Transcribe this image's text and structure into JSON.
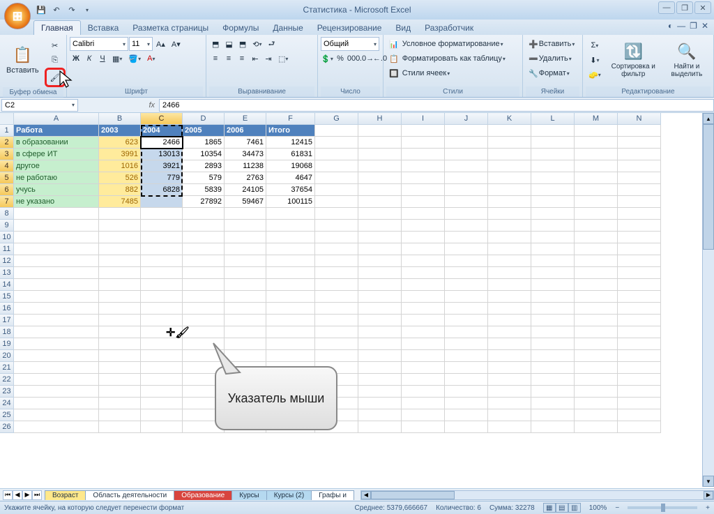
{
  "title": "Статистика - Microsoft Excel",
  "tabs": [
    "Главная",
    "Вставка",
    "Разметка страницы",
    "Формулы",
    "Данные",
    "Рецензирование",
    "Вид",
    "Разработчик"
  ],
  "active_tab": 0,
  "clipboard": {
    "paste": "Вставить",
    "label": "Буфер обмена"
  },
  "font": {
    "name": "Calibri",
    "size": "11",
    "label": "Шрифт",
    "bold": "Ж",
    "italic": "К",
    "underline": "Ч"
  },
  "align": {
    "label": "Выравнивание"
  },
  "number": {
    "label": "Число",
    "format": "Общий"
  },
  "styles": {
    "label": "Стили",
    "cond": "Условное форматирование",
    "table": "Форматировать как таблицу",
    "cell": "Стили ячеек"
  },
  "cells": {
    "label": "Ячейки",
    "insert": "Вставить",
    "delete": "Удалить",
    "format": "Формат"
  },
  "editing": {
    "label": "Редактирование",
    "sort": "Сортировка и фильтр",
    "find": "Найти и выделить"
  },
  "namebox": "C2",
  "formula": "2466",
  "columns": [
    "A",
    "B",
    "C",
    "D",
    "E",
    "F",
    "G",
    "H",
    "I",
    "J",
    "K",
    "L",
    "M",
    "N"
  ],
  "header_row": [
    "Работа",
    "2003",
    "2004",
    "2005",
    "2006",
    "Итого"
  ],
  "data_rows": [
    {
      "label": "в образовании",
      "y2003": "623",
      "vals": [
        "2466",
        "1865",
        "7461",
        "12415"
      ]
    },
    {
      "label": "в сфере ИТ",
      "y2003": "3991",
      "vals": [
        "13013",
        "10354",
        "34473",
        "61831"
      ]
    },
    {
      "label": "другое",
      "y2003": "1016",
      "vals": [
        "3921",
        "2893",
        "11238",
        "19068"
      ]
    },
    {
      "label": "не работаю",
      "y2003": "526",
      "vals": [
        "779",
        "579",
        "2763",
        "4647"
      ]
    },
    {
      "label": "учусь",
      "y2003": "882",
      "vals": [
        "6828",
        "5839",
        "24105",
        "37654"
      ]
    },
    {
      "label": "не указано",
      "y2003": "7485",
      "vals": [
        "",
        "27892",
        "59467",
        "100115"
      ]
    }
  ],
  "callout": "Указатель мыши",
  "sheets": [
    "Возраст",
    "Область деятельности",
    "Образование",
    "Курсы",
    "Курсы (2)",
    "Графы и"
  ],
  "status_left": "Укажите ячейку, на которую следует перенести формат",
  "status_avg_label": "Среднее:",
  "status_avg": "5379,666667",
  "status_cnt_label": "Количество:",
  "status_cnt": "6",
  "status_sum_label": "Сумма:",
  "status_sum": "32278",
  "zoom": "100%"
}
